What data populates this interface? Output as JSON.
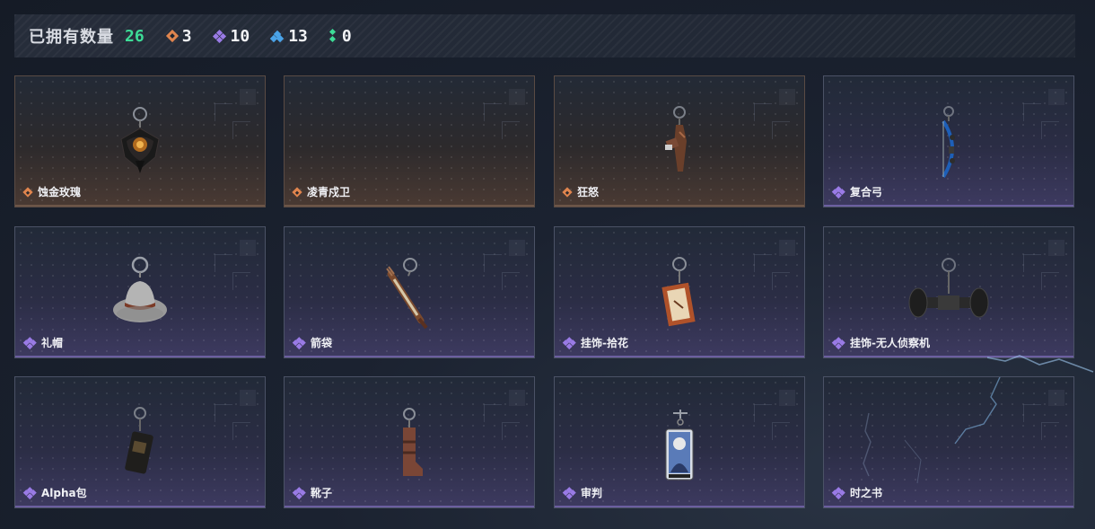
{
  "header": {
    "owned_label": "已拥有数量",
    "owned_count": "26",
    "stats": [
      {
        "icon": "orange-diamond-icon",
        "color": "#e0854e",
        "value": "3"
      },
      {
        "icon": "purple-quad-diamond-icon",
        "color": "#9a7be6",
        "value": "10"
      },
      {
        "icon": "blue-triple-diamond-icon",
        "color": "#4aa3e8",
        "value": "13"
      },
      {
        "icon": "green-double-diamond-icon",
        "color": "#3ddc97",
        "value": "0"
      }
    ]
  },
  "items": [
    {
      "name": "蚀金玫瑰",
      "rarity": "orange",
      "icon": "black-rose-charm-icon"
    },
    {
      "name": "凌青戍卫",
      "rarity": "orange",
      "icon": ""
    },
    {
      "name": "狂怒",
      "rarity": "orange",
      "icon": "rusty-gun-charm-icon"
    },
    {
      "name": "复合弓",
      "rarity": "purple",
      "icon": "blue-compound-bow-charm-icon"
    },
    {
      "name": "礼帽",
      "rarity": "purple",
      "icon": "grey-fedora-charm-icon"
    },
    {
      "name": "箭袋",
      "rarity": "purple",
      "icon": "quiver-charm-icon"
    },
    {
      "name": "挂饰-拾花",
      "rarity": "purple",
      "icon": "framed-picture-charm-icon"
    },
    {
      "name": "挂饰-无人侦察机",
      "rarity": "purple",
      "icon": "drone-wheels-charm-icon"
    },
    {
      "name": "Alpha包",
      "rarity": "purple",
      "icon": "alpha-pouch-charm-icon"
    },
    {
      "name": "靴子",
      "rarity": "purple",
      "icon": "boot-charm-icon"
    },
    {
      "name": "审判",
      "rarity": "purple",
      "icon": "judge-card-charm-icon"
    },
    {
      "name": "时之书",
      "rarity": "purple",
      "icon": ""
    }
  ]
}
